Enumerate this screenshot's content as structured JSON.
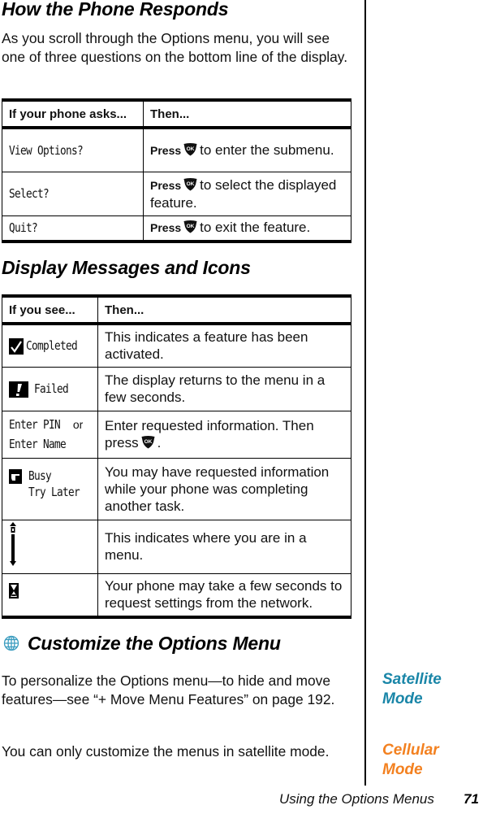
{
  "section1": {
    "title": "How the Phone Responds",
    "intro": "As you scroll through the Options menu, you will see one of three questions on the bottom line of the display.",
    "table": {
      "headers": [
        "If your phone asks...",
        "Then..."
      ],
      "rows": [
        {
          "prompt": "View Options?",
          "press": "Press",
          "button_icon": "ok-key-icon",
          "action": "to enter the submenu."
        },
        {
          "prompt": "Select?",
          "press": "Press",
          "button_icon": "ok-key-icon",
          "action": "to select the displayed feature."
        },
        {
          "prompt": "Quit?",
          "press": "Press",
          "button_icon": "ok-key-icon",
          "action": "to exit the feature."
        }
      ]
    }
  },
  "section2": {
    "title": "Display Messages and Icons",
    "table": {
      "headers": [
        "If you see...",
        "Then..."
      ],
      "rows": [
        {
          "icon": "checkmark-icon",
          "message": "Completed",
          "description": "This indicates a feature has been activated."
        },
        {
          "icon": "exclamation-icon",
          "message": "Failed",
          "description": "The display returns to the menu in a few seconds."
        },
        {
          "message_line1": "Enter PIN",
          "or": "or",
          "message_line2": "Enter Name",
          "description": "Enter requested information. Then press",
          "description_end": ".",
          "button_icon": "ok-key-icon"
        },
        {
          "icon": "pointing-hand-icon",
          "message_line1": "Busy",
          "message_line2": "Try Later",
          "description": "You may have requested information while your phone was completing another task."
        },
        {
          "icon": "scroll-position-icon",
          "description": "This indicates where you are in a menu."
        },
        {
          "icon": "hourglass-icon",
          "description": "Your phone may take a few seconds to request settings from the network."
        }
      ]
    }
  },
  "section3": {
    "icon": "globe-icon",
    "title": "Customize the Options Menu",
    "para1": "To personalize the Options menu—to hide and move features—see “+ Move Menu Features” on page 192.",
    "para2": "You can only customize the menus in satellite mode."
  },
  "sidenotes": {
    "satellite_line1": "Satellite",
    "satellite_line2": "Mode",
    "satellite_color": "#1a86a8",
    "cellular_line1": "Cellular",
    "cellular_line2": "Mode",
    "cellular_color": "#f38120"
  },
  "colors": {
    "globe": "#3a9cbf"
  },
  "footer": {
    "title": "Using the Options Menus",
    "page_number": "71"
  }
}
